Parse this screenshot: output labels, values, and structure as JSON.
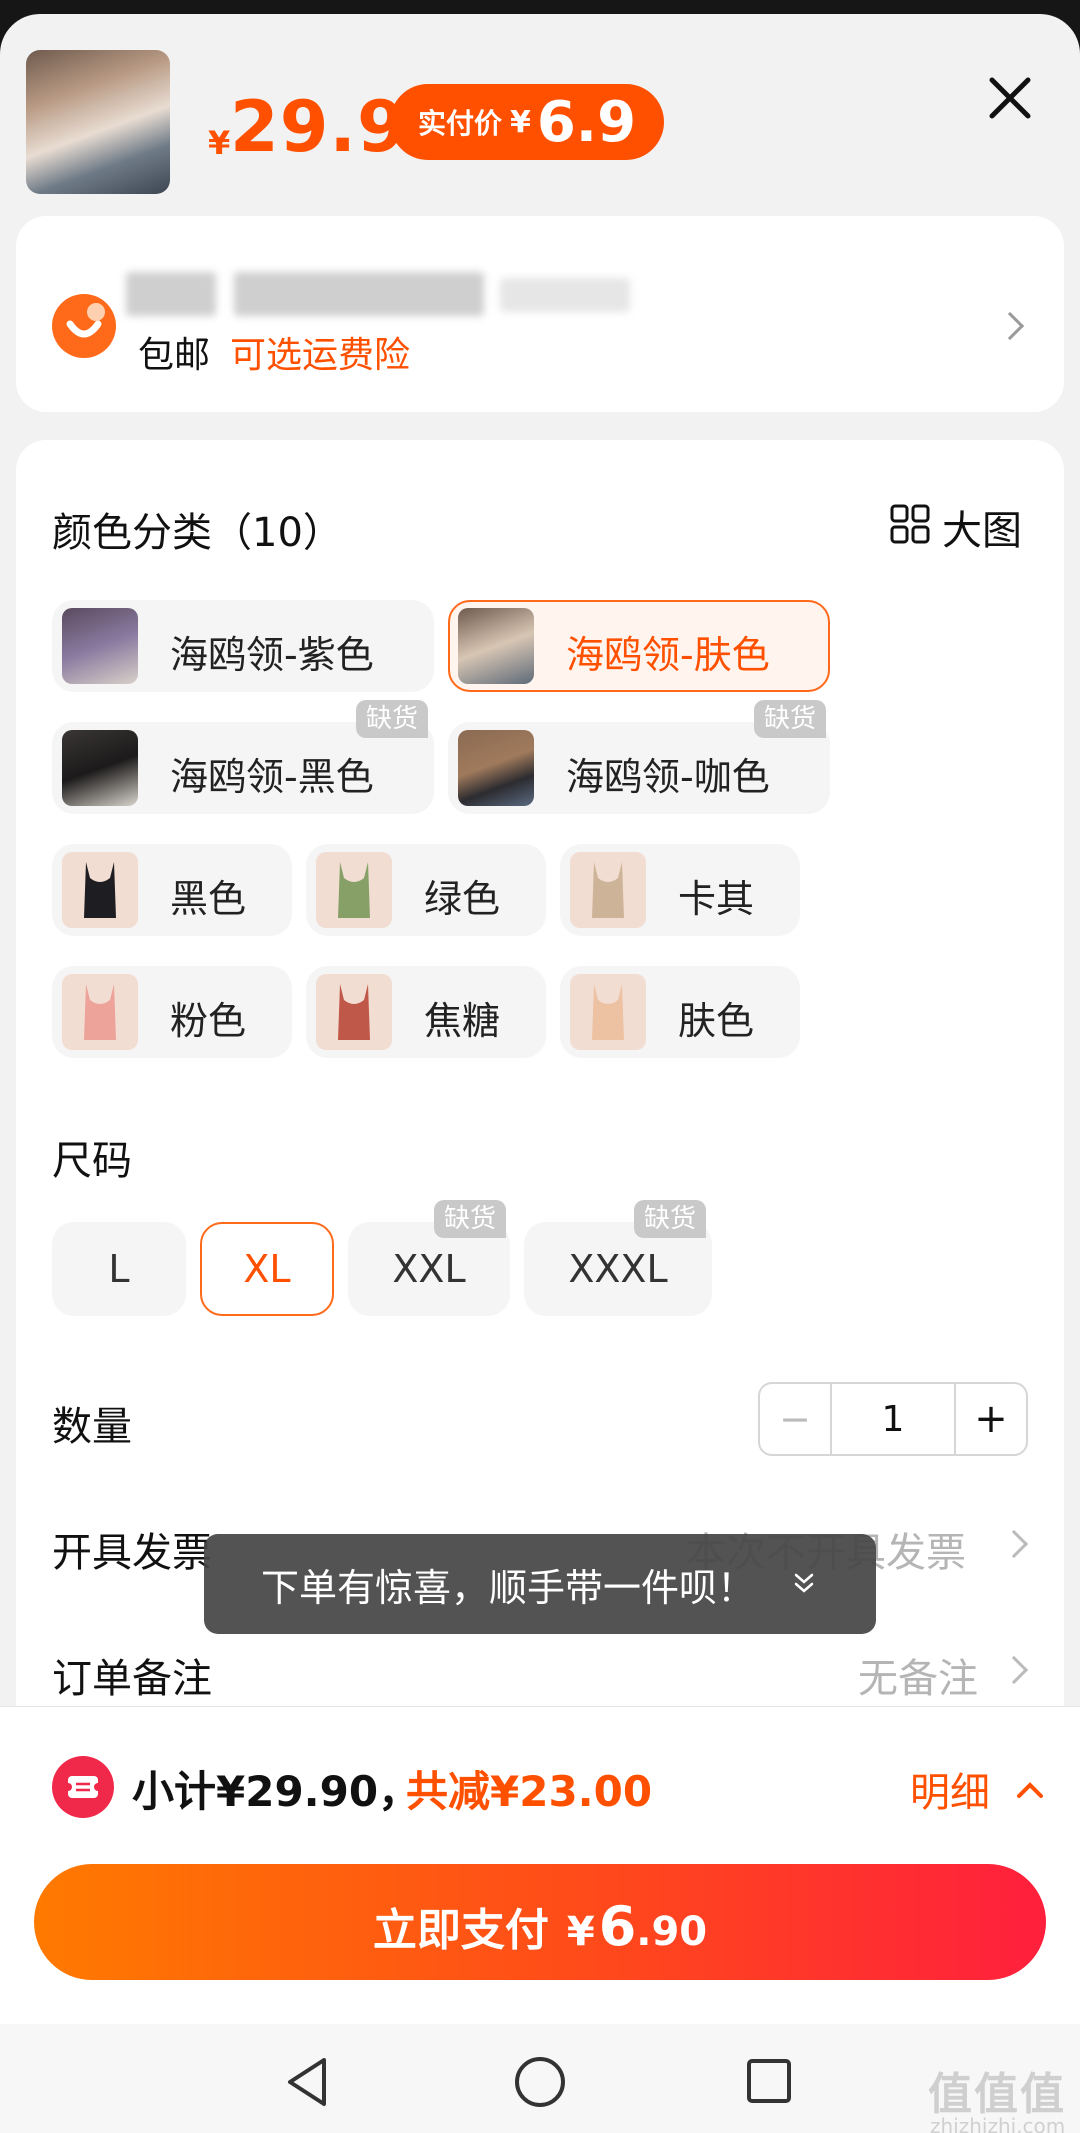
{
  "header": {
    "price_currency": "¥",
    "price": "29.9",
    "actual_label": "实付价",
    "actual_currency": "¥",
    "actual_price": "6.9"
  },
  "shipping": {
    "free_shipping": "包邮",
    "insurance": "可选运费险"
  },
  "color": {
    "title": "颜色分类（10）",
    "big_image_label": "大图",
    "items": [
      {
        "label": "海鸥领-紫色",
        "selected": false,
        "out_of_stock": false
      },
      {
        "label": "海鸥领-肤色",
        "selected": true,
        "out_of_stock": false
      },
      {
        "label": "海鸥领-黑色",
        "selected": false,
        "out_of_stock": true
      },
      {
        "label": "海鸥领-咖色",
        "selected": false,
        "out_of_stock": true
      },
      {
        "label": "黑色",
        "selected": false,
        "out_of_stock": false
      },
      {
        "label": "绿色",
        "selected": false,
        "out_of_stock": false
      },
      {
        "label": "卡其",
        "selected": false,
        "out_of_stock": false
      },
      {
        "label": "粉色",
        "selected": false,
        "out_of_stock": false
      },
      {
        "label": "焦糖",
        "selected": false,
        "out_of_stock": false
      },
      {
        "label": "肤色",
        "selected": false,
        "out_of_stock": false
      }
    ]
  },
  "out_of_stock_label": "缺货",
  "size": {
    "title": "尺码",
    "items": [
      {
        "label": "L",
        "selected": false,
        "out_of_stock": false
      },
      {
        "label": "XL",
        "selected": true,
        "out_of_stock": false
      },
      {
        "label": "XXL",
        "selected": false,
        "out_of_stock": true
      },
      {
        "label": "XXXL",
        "selected": false,
        "out_of_stock": true
      }
    ]
  },
  "quantity": {
    "label": "数量",
    "minus": "−",
    "value": "1",
    "plus": "+"
  },
  "invoice": {
    "label": "开具发票",
    "value": "本次不开具发票"
  },
  "remark": {
    "label": "订单备注",
    "value": "无备注"
  },
  "toast": {
    "text": "下单有惊喜，顺手带一件呗！",
    "icon": "double-chevron-down-icon"
  },
  "summary": {
    "subtotal": "小计¥29.90，",
    "discount": "共减¥23.00",
    "detail": "明细"
  },
  "pay": {
    "label": "立即支付",
    "currency": "¥",
    "integer": "6",
    "decimal": ".90"
  },
  "watermark": {
    "logo": "值值值",
    "url": "zhizhizhi.com"
  },
  "colors": {
    "accent": "#ff5000",
    "pay_gradient_start": "#ff7a00",
    "pay_gradient_end": "#ff1f3d",
    "out_of_stock_badge": "#c9c9c9"
  }
}
